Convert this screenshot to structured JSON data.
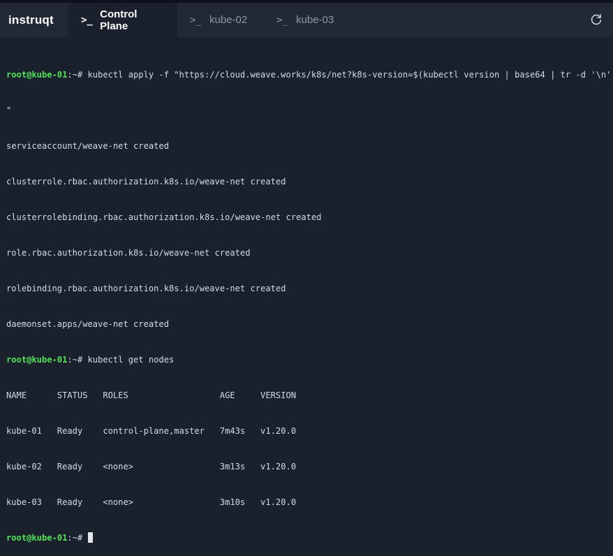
{
  "brand": {
    "name": "instruqt"
  },
  "tabs": [
    {
      "icon": "terminal-prompt-icon",
      "prompt": ">_",
      "label": "Control Plane",
      "active": true
    },
    {
      "icon": "terminal-prompt-icon",
      "prompt": ">_",
      "label": "kube-02",
      "active": false
    },
    {
      "icon": "terminal-prompt-icon",
      "prompt": ">_",
      "label": "kube-03",
      "active": false
    }
  ],
  "toolbar": {
    "refresh_icon": "refresh-icon"
  },
  "terminal": {
    "user": "root@kube-01",
    "path": ":~#",
    "commands": {
      "apply": " kubectl apply -f \"https://cloud.weave.works/k8s/net?k8s-version=$(kubectl version | base64 | tr -d '\\n')",
      "apply_cont": "\"",
      "get_nodes": " kubectl get nodes"
    },
    "apply_output": [
      "serviceaccount/weave-net created",
      "clusterrole.rbac.authorization.k8s.io/weave-net created",
      "clusterrolebinding.rbac.authorization.k8s.io/weave-net created",
      "role.rbac.authorization.k8s.io/weave-net created",
      "rolebinding.rbac.authorization.k8s.io/weave-net created",
      "daemonset.apps/weave-net created"
    ],
    "nodes_header": "NAME      STATUS   ROLES                  AGE     VERSION",
    "nodes_rows": [
      "kube-01   Ready    control-plane,master   7m43s   v1.20.0",
      "kube-02   Ready    <none>                 3m13s   v1.20.0",
      "kube-03   Ready    <none>                 3m10s   v1.20.0"
    ]
  },
  "colors": {
    "prompt_user": "#50e35a",
    "background": "#1a202c",
    "tabbar": "#222934"
  }
}
